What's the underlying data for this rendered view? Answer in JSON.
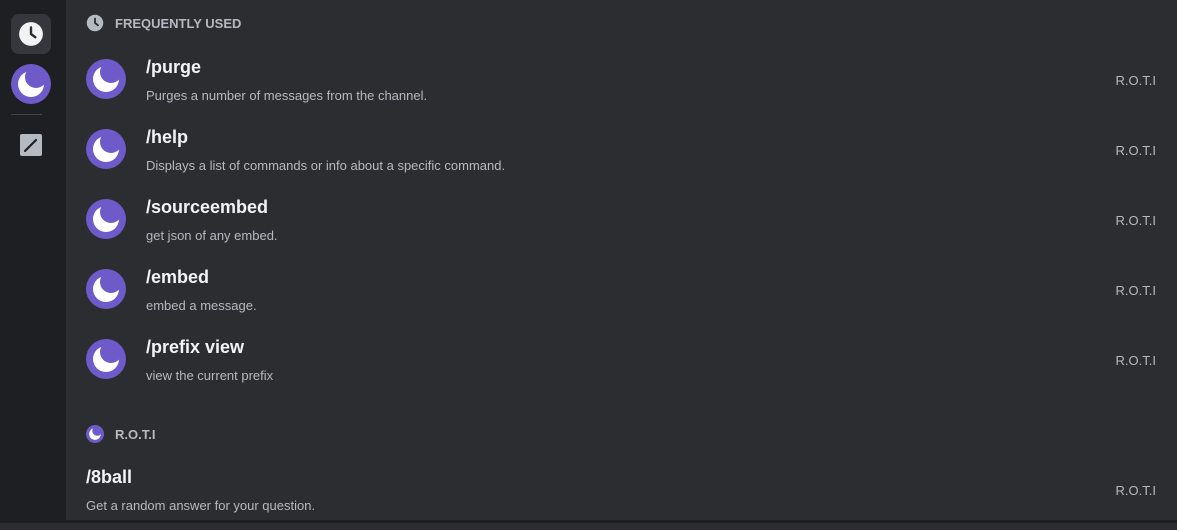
{
  "sidebar": {
    "items": [
      {
        "icon": "clock-icon",
        "active": true
      },
      {
        "icon": "bot-avatar-icon",
        "active": false
      },
      {
        "icon": "edit-icon",
        "active": false
      }
    ]
  },
  "frequent": {
    "header": "FREQUENTLY USED",
    "commands": [
      {
        "name": "/purge",
        "description": "Purges a number of messages from the channel.",
        "source": "R.O.T.I"
      },
      {
        "name": "/help",
        "description": "Displays a list of commands or info about a specific command.",
        "source": "R.O.T.I"
      },
      {
        "name": "/sourceembed",
        "description": "get json of any embed.",
        "source": "R.O.T.I"
      },
      {
        "name": "/embed",
        "description": "embed a message.",
        "source": "R.O.T.I"
      },
      {
        "name": "/prefix view",
        "description": "view the current prefix",
        "source": "R.O.T.I"
      }
    ]
  },
  "bot_section": {
    "header": "R.O.T.I",
    "commands": [
      {
        "name": "/8ball",
        "description": "Get a random answer for your question.",
        "source": "R.O.T.I"
      }
    ]
  },
  "colors": {
    "accent": "#5865f2",
    "avatar": "#6e5ac9",
    "background": "#2b2d31",
    "rail": "#1e1f22"
  }
}
